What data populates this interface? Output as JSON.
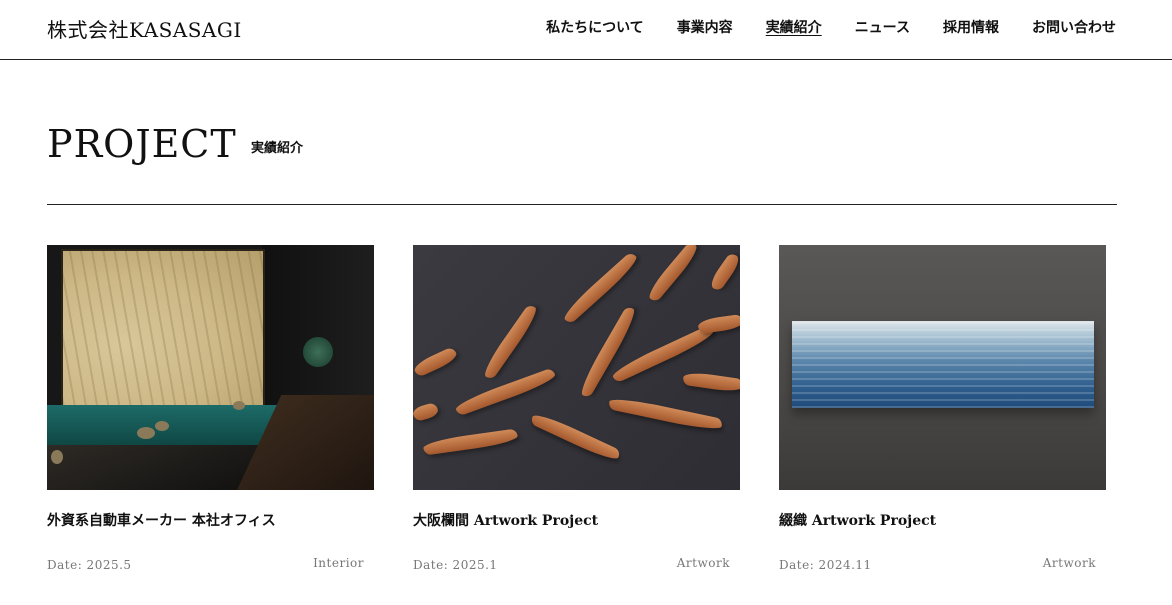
{
  "header": {
    "logo": "株式会社KASASAGI",
    "nav": [
      {
        "label": "私たちについて"
      },
      {
        "label": "事業内容"
      },
      {
        "label": "実績紹介"
      },
      {
        "label": "ニュース"
      },
      {
        "label": "採用情報"
      },
      {
        "label": "お問い合わせ"
      }
    ],
    "active_nav": "実績紹介"
  },
  "page": {
    "title": "PROJECT",
    "subtitle": "実績紹介"
  },
  "projects": [
    {
      "title": "外資系自動車メーカー 本社オフィス",
      "date": "Date: 2025.5",
      "category": "Interior"
    },
    {
      "title": "大阪欄間 Artwork Project",
      "date": "Date: 2025.1",
      "category": "Artwork"
    },
    {
      "title": "綴織 Artwork Project",
      "date": "Date: 2024.11",
      "category": "Artwork"
    }
  ]
}
